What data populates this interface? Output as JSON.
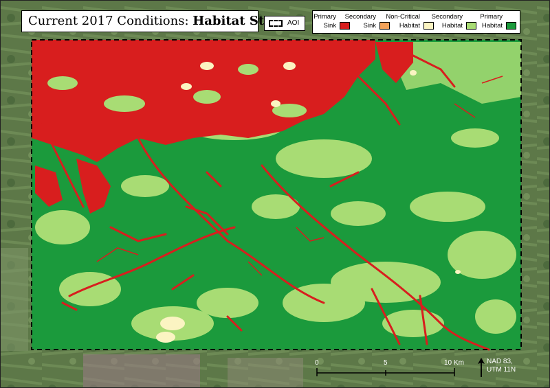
{
  "title": {
    "prefix": "Current 2017 Conditions: ",
    "bold": "Habitat States"
  },
  "aoi_legend": {
    "label": "AOI"
  },
  "legend": {
    "items": [
      {
        "line1": "Primary",
        "line2": "Sink",
        "color": "#d81e1e"
      },
      {
        "line1": "Secondary",
        "line2": "Sink",
        "color": "#f4a259"
      },
      {
        "line1": "Non-Critical",
        "line2": "Habitat",
        "color": "#fbf4c2"
      },
      {
        "line1": "Secondary",
        "line2": "Habitat",
        "color": "#a8dc74"
      },
      {
        "line1": "Primary",
        "line2": "Habitat",
        "color": "#1b9a3c"
      }
    ]
  },
  "scale_bar": {
    "labels": [
      "0",
      "5",
      "10 Km"
    ],
    "values_km": [
      0,
      5,
      10
    ]
  },
  "north_arrow": {
    "icon": "north-arrow-icon"
  },
  "projection": {
    "line1": "NAD 83,",
    "line2": "UTM 11N"
  },
  "colors": {
    "satellite": "#5f7a4a",
    "primary_sink": "#d81e1e",
    "secondary_sink": "#f4a259",
    "non_critical": "#fbf4c2",
    "secondary_habitat": "#a8dc74",
    "primary_habitat": "#1b9a3c"
  }
}
